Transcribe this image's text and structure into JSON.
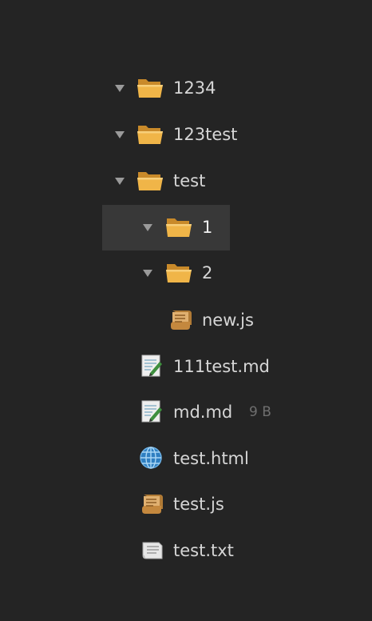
{
  "tree": {
    "items": [
      {
        "label": "1234",
        "icon": "folder-icon"
      },
      {
        "label": "123test",
        "icon": "folder-icon"
      },
      {
        "label": "test",
        "icon": "folder-icon"
      },
      {
        "label": "1",
        "icon": "folder-icon",
        "selected": true
      },
      {
        "label": "2",
        "icon": "folder-icon"
      },
      {
        "label": "new.js",
        "icon": "scroll-icon"
      },
      {
        "label": "111test.md",
        "icon": "memo-icon"
      },
      {
        "label": "md.md",
        "icon": "memo-icon",
        "meta": "9 B"
      },
      {
        "label": "test.html",
        "icon": "globe-icon"
      },
      {
        "label": "test.js",
        "icon": "scroll-icon"
      },
      {
        "label": "test.txt",
        "icon": "page-icon"
      }
    ]
  },
  "colors": {
    "background": "#242424",
    "selected": "#383838",
    "text": "#d6d6d6",
    "meta": "#6f6f6f",
    "folder": "#e5a63b"
  }
}
